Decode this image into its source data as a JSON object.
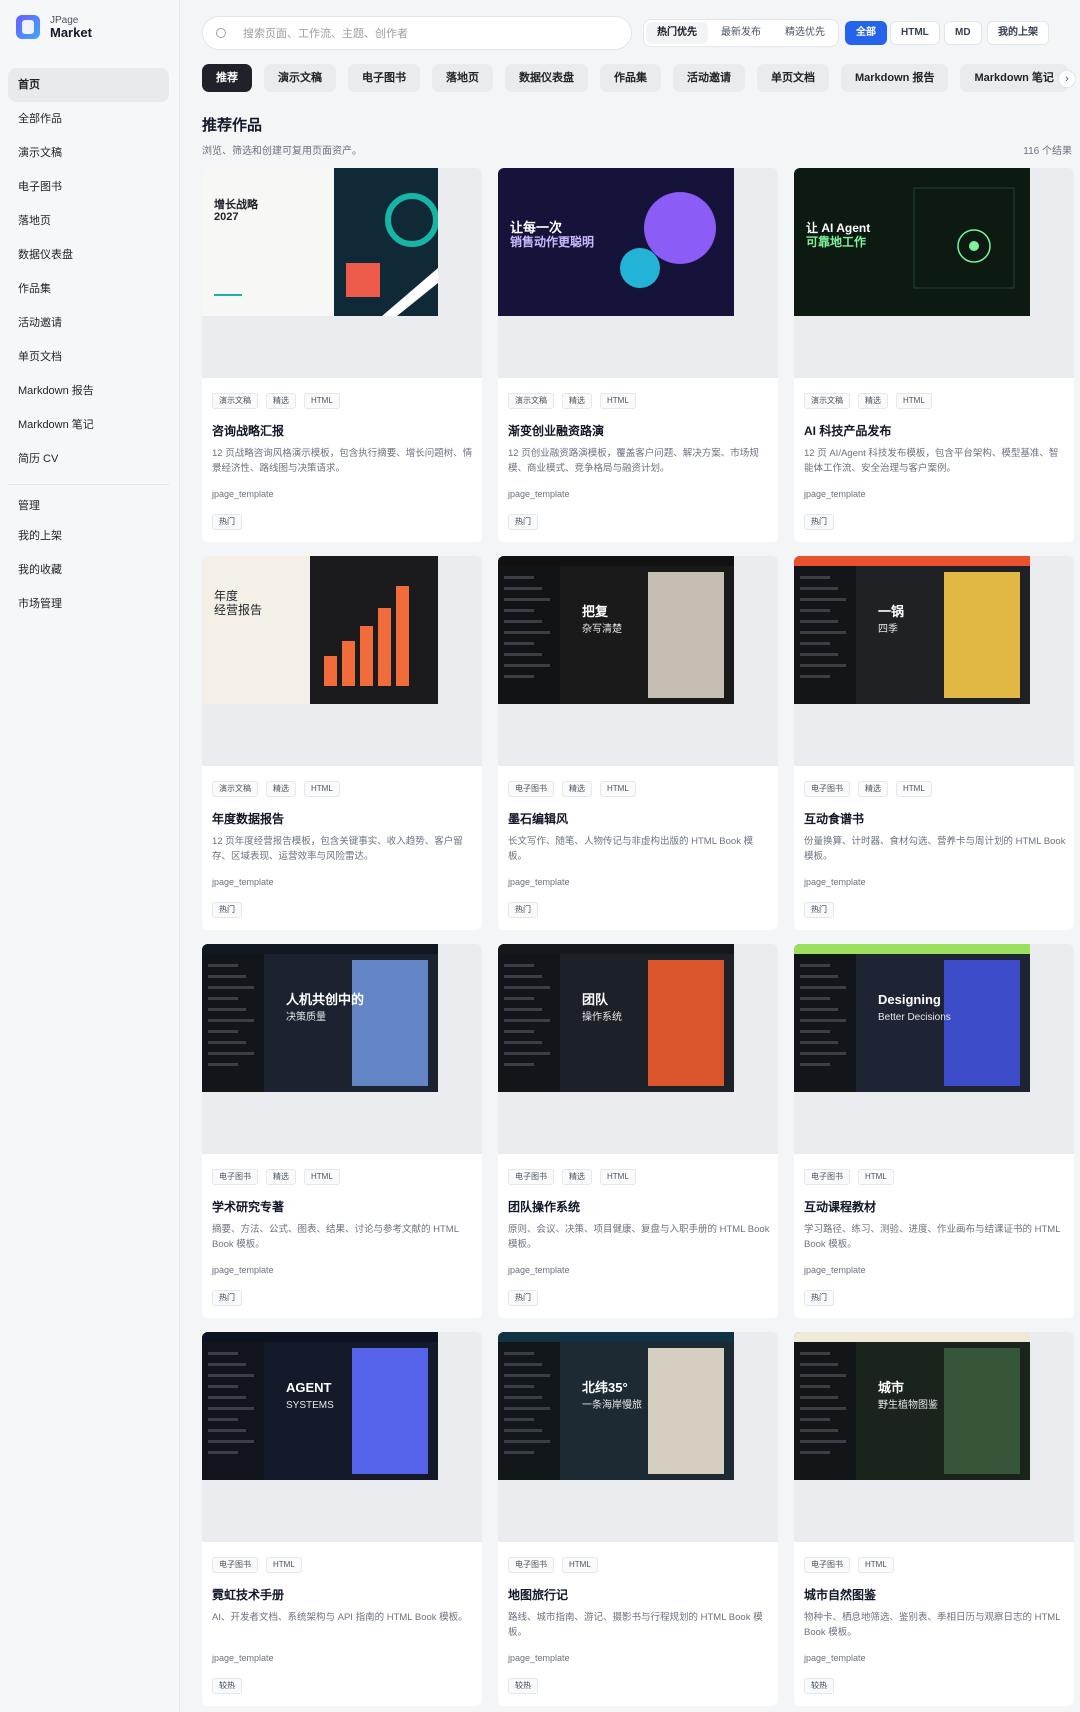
{
  "brand": {
    "top": "JPage",
    "bottom": "Market"
  },
  "sidebar": {
    "items": [
      {
        "label": "首页",
        "active": true
      },
      {
        "label": "全部作品"
      },
      {
        "label": "演示文稿"
      },
      {
        "label": "电子图书"
      },
      {
        "label": "落地页"
      },
      {
        "label": "数据仪表盘"
      },
      {
        "label": "作品集"
      },
      {
        "label": "活动邀请"
      },
      {
        "label": "单页文档"
      },
      {
        "label": "Markdown 报告"
      },
      {
        "label": "Markdown 笔记"
      },
      {
        "label": "简历 CV"
      }
    ],
    "section": "管理",
    "manage_items": [
      {
        "label": "我的上架"
      },
      {
        "label": "我的收藏"
      },
      {
        "label": "市场管理"
      }
    ]
  },
  "search": {
    "placeholder": "搜索页面、工作流、主题、创作者"
  },
  "sort": [
    "热门优先",
    "最新发布",
    "精选优先"
  ],
  "filters": {
    "all": "全部",
    "html": "HTML",
    "md": "MD",
    "mine": "我的上架"
  },
  "chips": [
    "推荐",
    "演示文稿",
    "电子图书",
    "落地页",
    "数据仪表盘",
    "作品集",
    "活动邀请",
    "单页文档",
    "Markdown 报告",
    "Markdown 笔记"
  ],
  "page": {
    "title": "推荐作品",
    "subtitle": "浏览、筛选和创建可复用页面资产。",
    "count": "116 个结果"
  },
  "cards": [
    {
      "tags": [
        "演示文稿",
        "精选",
        "HTML"
      ],
      "title": "咨询战略汇报",
      "desc": "12 页战略咨询风格演示模板，包含执行摘要、增长问题树、情景经济性、路线图与决策请求。",
      "author": "jpage_template",
      "badge": "热门",
      "thumb": {
        "bg": "#f7f7f5",
        "accent": "#ef5b4b",
        "dark": "#0f2a36",
        "text1": "增长战略",
        "text2": "2027"
      }
    },
    {
      "tags": [
        "演示文稿",
        "精选",
        "HTML"
      ],
      "title": "渐变创业融资路演",
      "desc": "12 页创业融资路演模板，覆盖客户问题、解决方案、市场规模、商业模式、竞争格局与融资计划。",
      "author": "jpage_template",
      "badge": "热门",
      "thumb": {
        "bg": "#16133a",
        "accent": "#8b5cf6",
        "dark": "#0b0a22",
        "text1": "让每一次",
        "text2": "销售动作更聪明"
      }
    },
    {
      "tags": [
        "演示文稿",
        "精选",
        "HTML"
      ],
      "title": "AI 科技产品发布",
      "desc": "12 页 AI/Agent 科技发布模板，包含平台架构、模型基准、智能体工作流、安全治理与客户案例。",
      "author": "jpage_template",
      "badge": "热门",
      "thumb": {
        "bg": "#0d1a12",
        "accent": "#7cf29a",
        "dark": "#07110b",
        "text1": "让 AI Agent",
        "text2": "可靠地工作"
      }
    },
    {
      "tags": [
        "演示文稿",
        "精选",
        "HTML"
      ],
      "title": "年度数据报告",
      "desc": "12 页年度经营报告模板，包含关键事实、收入趋势、客户留存、区域表现、运营效率与风险雷达。",
      "author": "jpage_template",
      "badge": "热门",
      "thumb": {
        "bg": "#f4f0e8",
        "accent": "#f26b3a",
        "dark": "#1b1b1d",
        "text1": "年度",
        "text2": "经营报告"
      }
    },
    {
      "tags": [
        "电子图书",
        "精选",
        "HTML"
      ],
      "title": "墨石编辑风",
      "desc": "长文写作、随笔、人物传记与非虚构出版的 HTML Book 模板。",
      "author": "jpage_template",
      "badge": "热门",
      "thumb": {
        "bg": "#1a1a1a",
        "accent": "#d8d2c4",
        "dark": "#111111",
        "text1": "把复",
        "text2": "杂写清楚"
      }
    },
    {
      "tags": [
        "电子图书",
        "精选",
        "HTML"
      ],
      "title": "互动食谱书",
      "desc": "份量换算、计时器、食材勾选、营养卡与周计划的 HTML Book 模板。",
      "author": "jpage_template",
      "badge": "热门",
      "thumb": {
        "bg": "#1f2124",
        "accent": "#f7c948",
        "dark": "#e8502e",
        "text1": "一锅",
        "text2": "四季"
      }
    },
    {
      "tags": [
        "电子图书",
        "精选",
        "HTML"
      ],
      "title": "学术研究专著",
      "desc": "摘要、方法、公式、图表、结果、讨论与参考文献的 HTML Book 模板。",
      "author": "jpage_template",
      "badge": "热门",
      "thumb": {
        "bg": "#1b2330",
        "accent": "#6b8fd6",
        "dark": "#121821",
        "text1": "人机共创中的",
        "text2": "决策质量"
      }
    },
    {
      "tags": [
        "电子图书",
        "精选",
        "HTML"
      ],
      "title": "团队操作系统",
      "desc": "原则、会议、决策、项目健康、复盘与入职手册的 HTML Book 模板。",
      "author": "jpage_template",
      "badge": "热门",
      "thumb": {
        "bg": "#1c2128",
        "accent": "#f05a2c",
        "dark": "#14181d",
        "text1": "团队",
        "text2": "操作系统"
      }
    },
    {
      "tags": [
        "电子图书",
        "HTML"
      ],
      "title": "互动课程教材",
      "desc": "学习路径、练习、测验、进度、作业画布与结课证书的 HTML Book 模板。",
      "author": "jpage_template",
      "badge": "热门",
      "thumb": {
        "bg": "#1e2433",
        "accent": "#3f51d8",
        "dark": "#9be15d",
        "text1": "Designing",
        "text2": "Better Decisions"
      }
    },
    {
      "tags": [
        "电子图书",
        "HTML"
      ],
      "title": "霓虹技术手册",
      "desc": "AI、开发者文档、系统架构与 API 指南的 HTML Book 模板。",
      "author": "jpage_template",
      "badge": "较热",
      "thumb": {
        "bg": "#141a2a",
        "accent": "#5b6cff",
        "dark": "#0d1220",
        "text1": "AGENT",
        "text2": "SYSTEMS"
      }
    },
    {
      "tags": [
        "电子图书",
        "HTML"
      ],
      "title": "地图旅行记",
      "desc": "路线、城市指南、游记、摄影书与行程规划的 HTML Book 模板。",
      "author": "jpage_template",
      "badge": "较热",
      "thumb": {
        "bg": "#1d2a33",
        "accent": "#e9e1cf",
        "dark": "#0f3342",
        "text1": "北纬35°",
        "text2": "一条海岸慢旅"
      }
    },
    {
      "tags": [
        "电子图书",
        "HTML"
      ],
      "title": "城市自然图鉴",
      "desc": "物种卡、栖息地筛选、鉴别表、季相日历与观察日志的 HTML Book 模板。",
      "author": "jpage_template",
      "badge": "较热",
      "thumb": {
        "bg": "#1b231d",
        "accent": "#3a5c3e",
        "dark": "#efe9d8",
        "text1": "城市",
        "text2": "野生植物图鉴"
      }
    }
  ]
}
